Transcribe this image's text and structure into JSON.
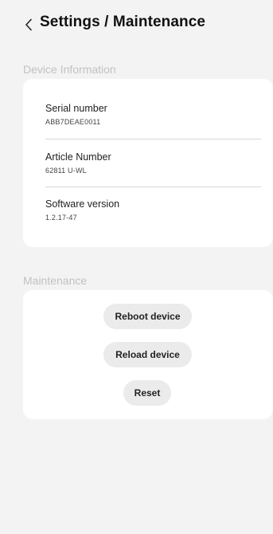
{
  "header": {
    "back_icon": "chevron-left-icon",
    "title": "Settings / Maintenance"
  },
  "device_info": {
    "section_label": "Device Information",
    "rows": [
      {
        "label": "Serial number",
        "value": "ABB7DEAE0011"
      },
      {
        "label": "Article Number",
        "value": "62811 U-WL"
      },
      {
        "label": "Software version",
        "value": "1.2.17-47"
      }
    ]
  },
  "maintenance": {
    "section_label": "Maintenance",
    "reboot_label": "Reboot device",
    "reload_label": "Reload device",
    "reset_label": "Reset"
  },
  "colors": {
    "background": "#f3f3f3",
    "card": "#ffffff",
    "button": "#ebebeb",
    "section_label": "#c2c2c2"
  }
}
